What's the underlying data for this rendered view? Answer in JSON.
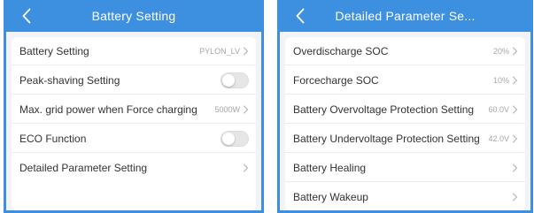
{
  "left_screen": {
    "title": "Battery Setting",
    "rows": [
      {
        "label": "Battery Setting",
        "value": "PYLON_LV"
      },
      {
        "label": "Peak-shaving Setting",
        "toggle": false
      },
      {
        "label": "Max. grid power when Force charging",
        "value": "5000W"
      },
      {
        "label": "ECO Function",
        "toggle": false
      },
      {
        "label": "Detailed Parameter Setting",
        "value": ""
      }
    ]
  },
  "right_screen": {
    "title": "Detailed Parameter Se...",
    "rows": [
      {
        "label": "Overdischarge SOC",
        "value": "20%"
      },
      {
        "label": "Forcecharge SOC",
        "value": "10%"
      },
      {
        "label": "Battery Overvoltage Protection Setting",
        "value": "60.0V"
      },
      {
        "label": "Battery Undervoltage Protection Setting",
        "value": "42.0V"
      },
      {
        "label": "Battery Healing",
        "value": ""
      },
      {
        "label": "Battery Wakeup",
        "value": ""
      }
    ]
  },
  "icons": {
    "back": "chevron-left-icon",
    "row_arrow": "chevron-right-icon"
  },
  "colors": {
    "header": "#3d8fe0",
    "background": "#f2f2f7",
    "card": "#ffffff",
    "label_text": "#333333",
    "value_text": "#a6a6a6",
    "toggle_off": "#e6e6e6"
  }
}
